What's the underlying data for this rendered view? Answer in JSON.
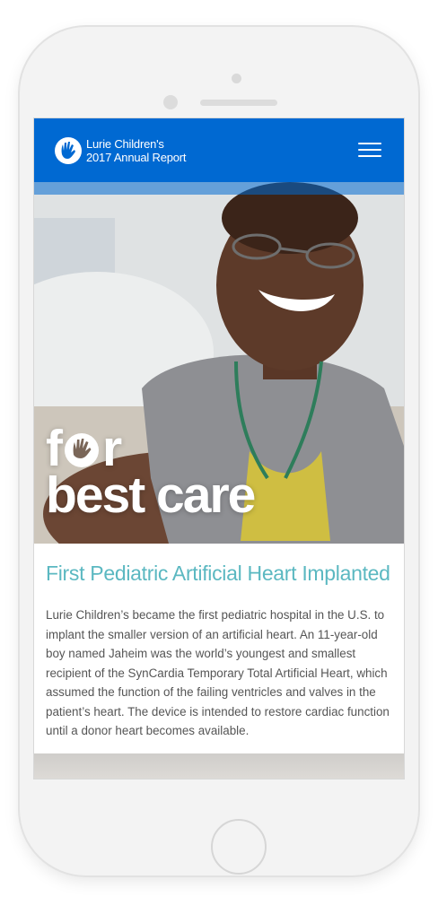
{
  "header": {
    "brand_line1": "Lurie Children's",
    "brand_line2": "2017 Annual Report",
    "menu_icon": "hamburger-menu-icon"
  },
  "hero": {
    "headline_line1_a": "f",
    "headline_line1_b": "r",
    "headline_line2": "best care"
  },
  "article": {
    "title": "First Pediatric Artificial Heart Implanted",
    "body": "Lurie Children’s became the first pediatric hospital in the U.S. to implant the smaller version of an artificial heart. An 11-year-old boy named Jaheim was the world’s youngest and smallest recipient of the SynCardia Temporary Total Artificial Heart, which assumed the function of the failing ventricles and valves in the patient’s heart. The device is intended to restore cardiac function until a donor heart becomes available."
  },
  "colors": {
    "header_blue": "#0069d2",
    "title_teal": "#5bb8c1",
    "body_text": "#555555"
  }
}
